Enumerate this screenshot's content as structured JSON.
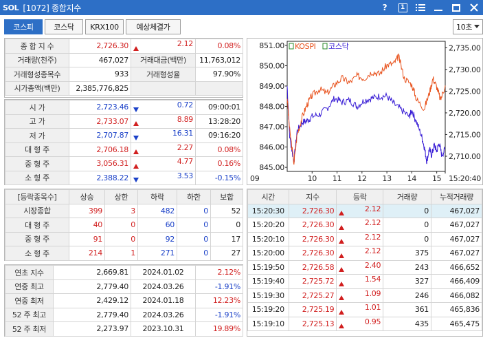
{
  "titlebar": {
    "logo": "SOL",
    "title": "[1072] 종합지수",
    "help": "?",
    "window_number": "1",
    "menu_icon": "hamburger-icon",
    "min_icon": "minimize-icon",
    "max_icon": "maximize-icon",
    "close_icon": "close-icon"
  },
  "tabs": [
    {
      "label": "코스피",
      "active": true
    },
    {
      "label": "코스닥",
      "active": false
    },
    {
      "label": "KRX100",
      "active": false
    },
    {
      "label": "예상체결가",
      "active": false
    }
  ],
  "interval_select": "10초",
  "colors": {
    "accent": "#2d6fc6",
    "up": "#d11f1f",
    "down": "#1b41c8",
    "kospi_line": "#e8501a",
    "kosdaq_line": "#3a1fd6"
  },
  "summary": {
    "index_label": "종 합 지 수",
    "index_value": "2,726.30",
    "index_change": "2.12",
    "index_rate": "0.08%",
    "volume_label": "거래량(천주)",
    "volume_value": "467,027",
    "amount_label": "거래대금(백만)",
    "amount_value": "11,763,012",
    "formed_count_label": "거래형성종목수",
    "formed_count_value": "933",
    "formed_rate_label": "거래형성율",
    "formed_rate_value": "97.90%",
    "mcap_label": "시가총액(백만)",
    "mcap_value": "2,385,776,825"
  },
  "prices": [
    {
      "label": "시      가",
      "value": "2,723.46",
      "dir": "down",
      "change": "0.72",
      "extra": "09:00:01",
      "extra_color": ""
    },
    {
      "label": "고      가",
      "value": "2,733.07",
      "dir": "up",
      "change": "8.89",
      "extra": "13:28:20",
      "extra_color": ""
    },
    {
      "label": "저      가",
      "value": "2,707.87",
      "dir": "down",
      "change": "16.31",
      "extra": "09:16:20",
      "extra_color": ""
    },
    {
      "label": "대 형 주",
      "value": "2,706.18",
      "dir": "up",
      "change": "2.27",
      "extra": "0.08%",
      "extra_color": "red"
    },
    {
      "label": "중 형 주",
      "value": "3,056.31",
      "dir": "up",
      "change": "4.77",
      "extra": "0.16%",
      "extra_color": "red"
    },
    {
      "label": "소 형 주",
      "value": "2,388.22",
      "dir": "down",
      "change": "3.53",
      "extra": "-0.15%",
      "extra_color": "blue"
    }
  ],
  "breadth": {
    "headers": [
      "[등락종목수]",
      "상승",
      "상한",
      "하락",
      "하한",
      "보합"
    ],
    "rows": [
      {
        "label": "시장종합",
        "up": "399",
        "upper": "3",
        "down": "482",
        "lower": "0",
        "flat": "52"
      },
      {
        "label": "대 형 주",
        "up": "40",
        "upper": "0",
        "down": "60",
        "lower": "0",
        "flat": "0"
      },
      {
        "label": "중 형 주",
        "up": "91",
        "upper": "0",
        "down": "92",
        "lower": "0",
        "flat": "17"
      },
      {
        "label": "소 형 주",
        "up": "214",
        "upper": "1",
        "down": "271",
        "lower": "0",
        "flat": "27"
      }
    ]
  },
  "yearly": [
    {
      "label": "연초  지수",
      "value": "2,669.81",
      "date": "2024.01.02",
      "rate": "2.12%",
      "rate_color": "red"
    },
    {
      "label": "연중  최고",
      "value": "2,779.40",
      "date": "2024.03.26",
      "rate": "-1.91%",
      "rate_color": "blue"
    },
    {
      "label": "연중  최저",
      "value": "2,429.12",
      "date": "2024.01.18",
      "rate": "12.23%",
      "rate_color": "red"
    },
    {
      "label": "52 주 최고",
      "value": "2,779.40",
      "date": "2024.03.26",
      "rate": "-1.91%",
      "rate_color": "blue"
    },
    {
      "label": "52 주 최저",
      "value": "2,273.97",
      "date": "2023.10.31",
      "rate": "19.89%",
      "rate_color": "red"
    }
  ],
  "ticks": {
    "headers": [
      "시간",
      "지수",
      "등락",
      "거래량",
      "누적거래량"
    ],
    "rows": [
      {
        "time": "15:20:30",
        "index": "2,726.30",
        "change": "2.12",
        "vol": "0",
        "cum": "467,027",
        "hl": true
      },
      {
        "time": "15:20:20",
        "index": "2,726.30",
        "change": "2.12",
        "vol": "0",
        "cum": "467,027",
        "hl": false
      },
      {
        "time": "15:20:10",
        "index": "2,726.30",
        "change": "2.12",
        "vol": "0",
        "cum": "467,027",
        "hl": false
      },
      {
        "time": "15:20:00",
        "index": "2,726.30",
        "change": "2.12",
        "vol": "375",
        "cum": "467,027",
        "hl": false
      },
      {
        "time": "15:19:50",
        "index": "2,726.58",
        "change": "2.40",
        "vol": "243",
        "cum": "466,652",
        "hl": false
      },
      {
        "time": "15:19:40",
        "index": "2,725.72",
        "change": "1.54",
        "vol": "327",
        "cum": "466,409",
        "hl": false
      },
      {
        "time": "15:19:30",
        "index": "2,725.27",
        "change": "1.09",
        "vol": "246",
        "cum": "466,082",
        "hl": false
      },
      {
        "time": "15:19:20",
        "index": "2,725.19",
        "change": "1.01",
        "vol": "361",
        "cum": "465,836",
        "hl": false
      },
      {
        "time": "15:19:10",
        "index": "2,725.13",
        "change": "0.95",
        "vol": "435",
        "cum": "465,475",
        "hl": false
      }
    ]
  },
  "chart_data": {
    "type": "line",
    "legend": [
      "KOSPI",
      "코스닥"
    ],
    "left_axis": {
      "ticks": [
        "851.00",
        "850.00",
        "849.00",
        "848.00",
        "847.00",
        "846.00",
        "845.00"
      ],
      "ylim": [
        844.8,
        851.2
      ]
    },
    "right_axis": {
      "ticks": [
        "2,735.00",
        "2,730.00",
        "2,725.00",
        "2,720.00",
        "2,715.00",
        "2,710.00"
      ],
      "ylim": [
        2706.5,
        2736.5
      ]
    },
    "x_ticks": [
      "09",
      "10",
      "11",
      "12",
      "13",
      "14",
      "15",
      "15:20:40"
    ],
    "x_hours": [
      9,
      10,
      11,
      12,
      13,
      14,
      15,
      15.34
    ],
    "series": [
      {
        "name": "KOSPI",
        "axis": "right",
        "x": [
          9.0,
          9.1,
          9.27,
          9.4,
          9.6,
          9.8,
          10.0,
          10.3,
          10.6,
          10.9,
          11.2,
          11.5,
          11.8,
          12.1,
          12.4,
          12.7,
          13.0,
          13.3,
          13.47,
          13.7,
          14.0,
          14.2,
          14.5,
          14.7,
          14.85,
          15.0,
          15.15,
          15.34
        ],
        "y": [
          2723.5,
          2716.0,
          2708.5,
          2715.0,
          2719.0,
          2722.0,
          2724.0,
          2725.5,
          2724.5,
          2726.5,
          2728.0,
          2727.0,
          2728.5,
          2728.0,
          2729.5,
          2729.0,
          2731.0,
          2731.5,
          2733.0,
          2728.0,
          2726.5,
          2723.0,
          2721.0,
          2724.5,
          2728.0,
          2726.0,
          2723.0,
          2726.3
        ]
      },
      {
        "name": "코스닥",
        "axis": "left",
        "x": [
          9.0,
          9.1,
          9.27,
          9.4,
          9.6,
          9.8,
          10.0,
          10.3,
          10.6,
          10.9,
          11.2,
          11.5,
          11.8,
          12.1,
          12.4,
          12.7,
          13.0,
          13.3,
          13.6,
          13.9,
          14.0,
          14.2,
          14.4,
          14.5,
          14.6,
          14.7,
          14.8,
          14.9,
          15.0,
          15.1,
          15.2,
          15.34
        ],
        "y": [
          849.0,
          846.5,
          845.3,
          846.8,
          847.2,
          847.3,
          847.5,
          847.6,
          847.9,
          848.4,
          848.2,
          848.3,
          848.0,
          848.3,
          848.4,
          848.5,
          848.5,
          848.1,
          847.8,
          847.5,
          847.8,
          847.2,
          846.5,
          846.0,
          845.3,
          845.9,
          845.6,
          846.1,
          845.8,
          846.2,
          845.6,
          845.9
        ]
      }
    ]
  }
}
